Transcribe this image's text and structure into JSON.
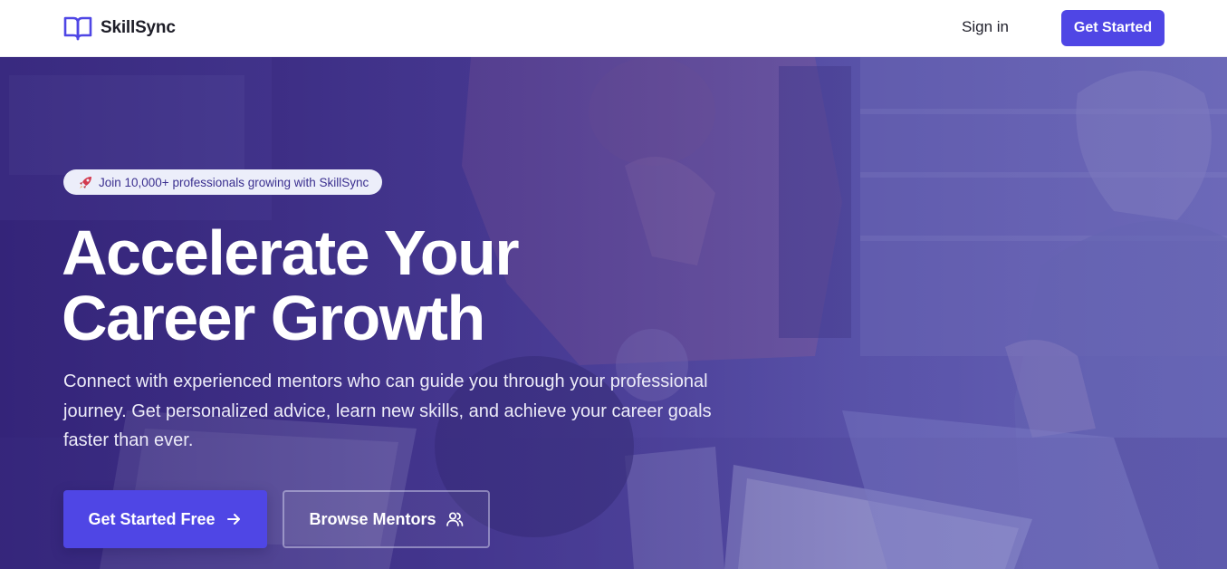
{
  "brand": {
    "name": "SkillSync",
    "icon": "book-open-icon",
    "accent": "#4f46e5"
  },
  "nav": {
    "signin_label": "Sign in",
    "cta_label": "Get Started"
  },
  "hero": {
    "badge": {
      "icon": "rocket-icon",
      "text": "Join 10,000+ professionals growing with SkillSync"
    },
    "headline_line1": "Accelerate Your",
    "headline_line2": "Career Growth",
    "subtitle": "Connect with experienced mentors who can guide you through your professional journey. Get personalized advice, learn new skills, and achieve your career goals faster than ever.",
    "primary_button": {
      "label": "Get Started Free",
      "icon": "arrow-right-icon"
    },
    "secondary_button": {
      "label": "Browse Mentors",
      "icon": "users-icon"
    }
  },
  "colors": {
    "primary": "#4f46e5",
    "hero_tint": "#4a3d97",
    "badge_bg": "#eceefa"
  }
}
